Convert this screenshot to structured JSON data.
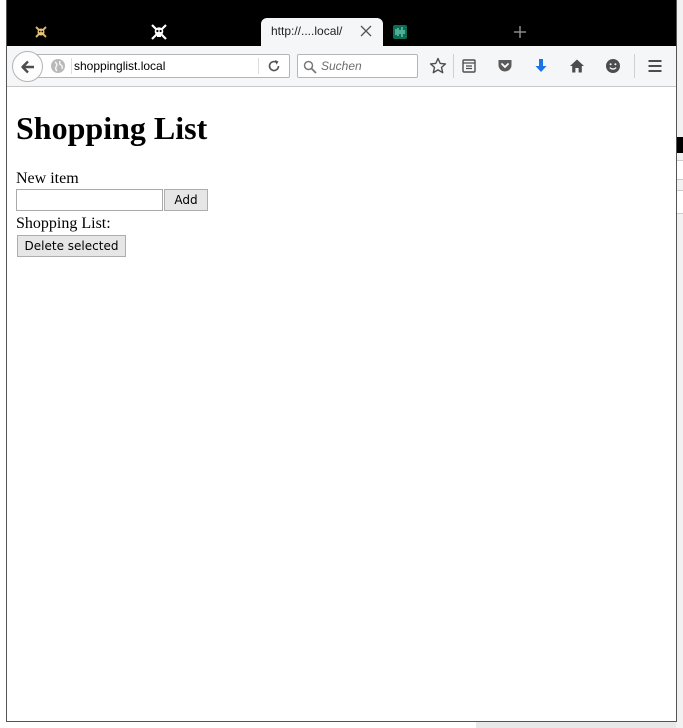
{
  "browser": {
    "tabs": [
      {
        "icon": "pirate-skull-icon",
        "active": false
      },
      {
        "icon": "skull-crossbones-icon",
        "active": false
      },
      {
        "title": "http://....local/",
        "active": true
      },
      {
        "icon": "audio-wave-icon",
        "active": false
      }
    ],
    "url": "shoppinglist.local",
    "search_placeholder": "Suchen",
    "toolbar_icons": [
      "bookmark-star-icon",
      "reading-list-icon",
      "pocket-icon",
      "download-arrow-icon",
      "home-icon",
      "smiley-icon",
      "hamburger-menu-icon"
    ],
    "colors": {
      "tabstrip": "#000000",
      "toolbar": "#f5f6f7",
      "download_accent": "#1a73e8",
      "pocket": "#5b5b5b"
    }
  },
  "page": {
    "title": "Shopping List",
    "new_item_label": "New item",
    "new_item_value": "",
    "add_button": "Add",
    "list_label": "Shopping List:",
    "delete_button": "Delete selected"
  }
}
